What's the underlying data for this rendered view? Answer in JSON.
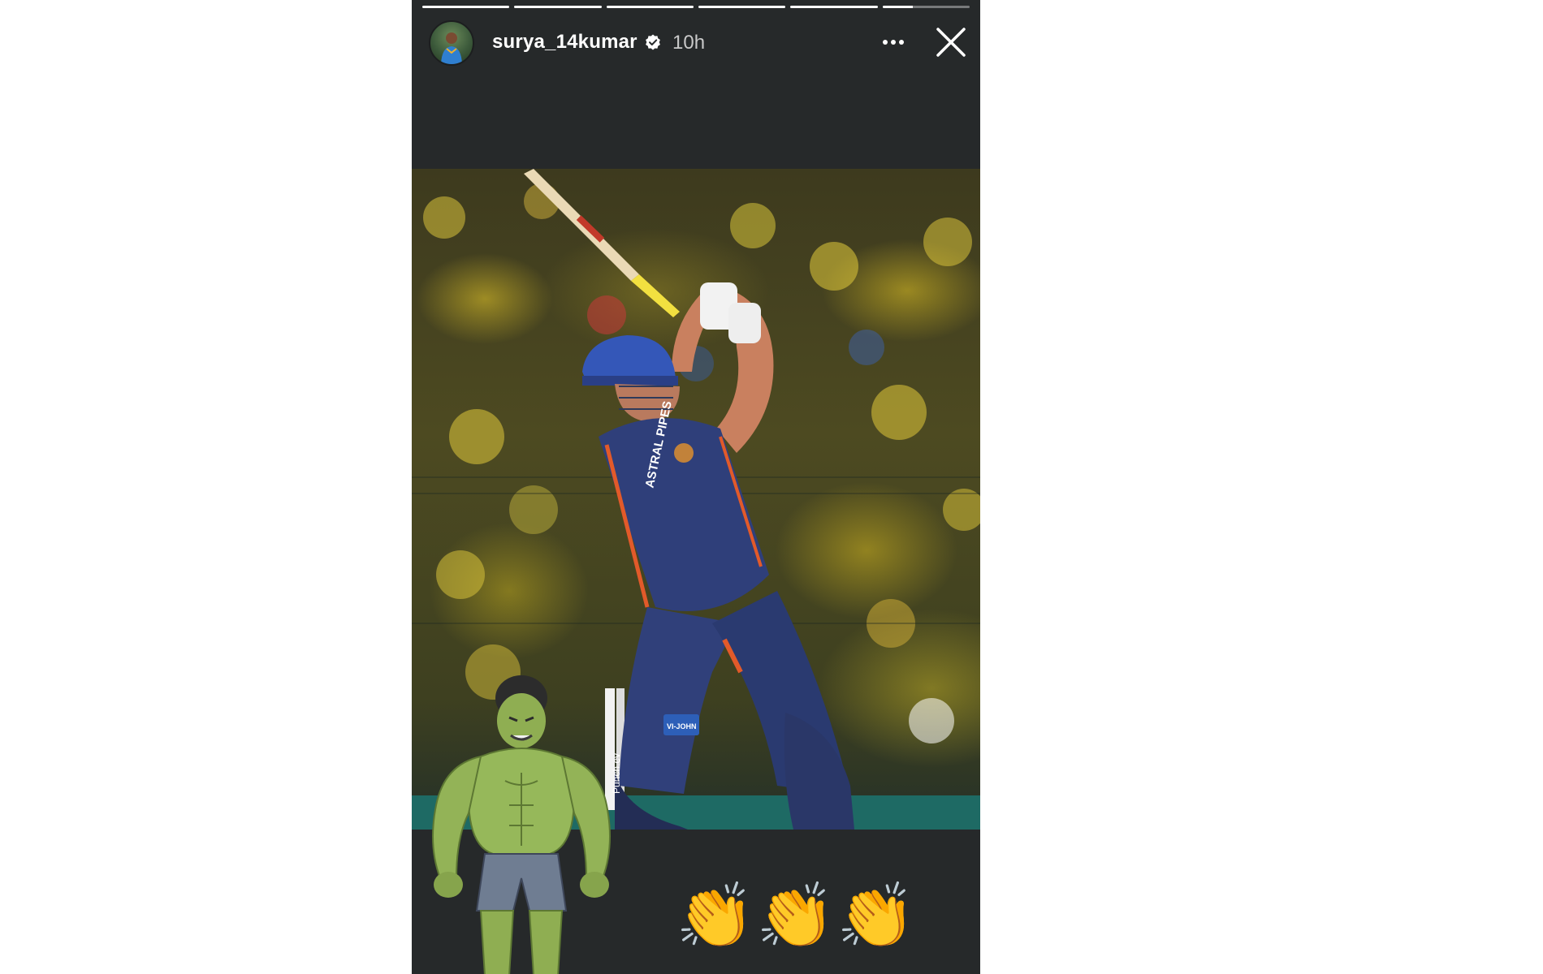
{
  "story": {
    "progress_segments": [
      1,
      1,
      1,
      1,
      1,
      0.35
    ],
    "header": {
      "username": "surya_14kumar",
      "verified": true,
      "time_ago": "10h"
    },
    "icons": {
      "avatar": "avatar",
      "verified": "verified-badge-icon",
      "more": "more-options-icon",
      "close": "close-icon"
    },
    "photo": {
      "subject": "cricket batter",
      "jersey_sponsor": "ASTRAL PIPES",
      "pad_sponsor": "VI-JOHN",
      "stump_text": "Punch.ev"
    },
    "stickers": {
      "hulk": "hulk-sticker",
      "claps": [
        "👏",
        "👏",
        "👏"
      ]
    }
  }
}
